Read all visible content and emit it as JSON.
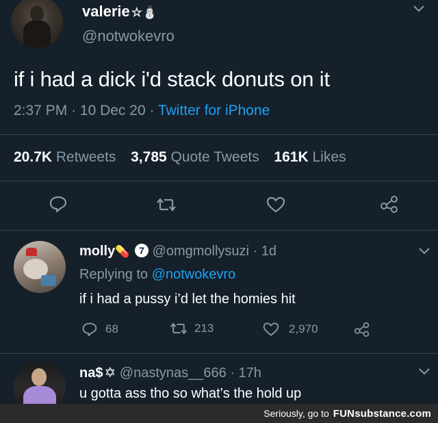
{
  "main_tweet": {
    "display_name": "valerie",
    "name_emojis": "☆⛄",
    "handle": "@notwokevro",
    "text": "if i had a dick i'd stack donuts on it",
    "time": "2:37 PM",
    "date": "10 Dec 20",
    "source": "Twitter for iPhone",
    "stats": {
      "retweets_count": "20.7K",
      "retweets_label": "Retweets",
      "quotes_count": "3,785",
      "quotes_label": "Quote Tweets",
      "likes_count": "161K",
      "likes_label": "Likes"
    }
  },
  "replies": [
    {
      "display_name": "molly",
      "name_emoji": "💊",
      "badge": "7",
      "handle": "@omgmollysuzi",
      "age": "1d",
      "replying_prefix": "Replying to",
      "replying_to": "@notwokevro",
      "text": "if i had a pussy i’d let the homies hit",
      "replies_count": "68",
      "retweets_count": "213",
      "likes_count": "2,970"
    },
    {
      "display_name": "na$",
      "name_emoji": "✡",
      "handle": "@nastynas__666",
      "age": "17h",
      "text": "u gotta ass tho so what’s the hold up"
    }
  ],
  "footer": {
    "prefix": "Seriously, go to",
    "brand": "FUNsubstance.com"
  },
  "colors": {
    "background": "#15202b",
    "muted": "#8899a6",
    "link": "#1da1f2"
  }
}
